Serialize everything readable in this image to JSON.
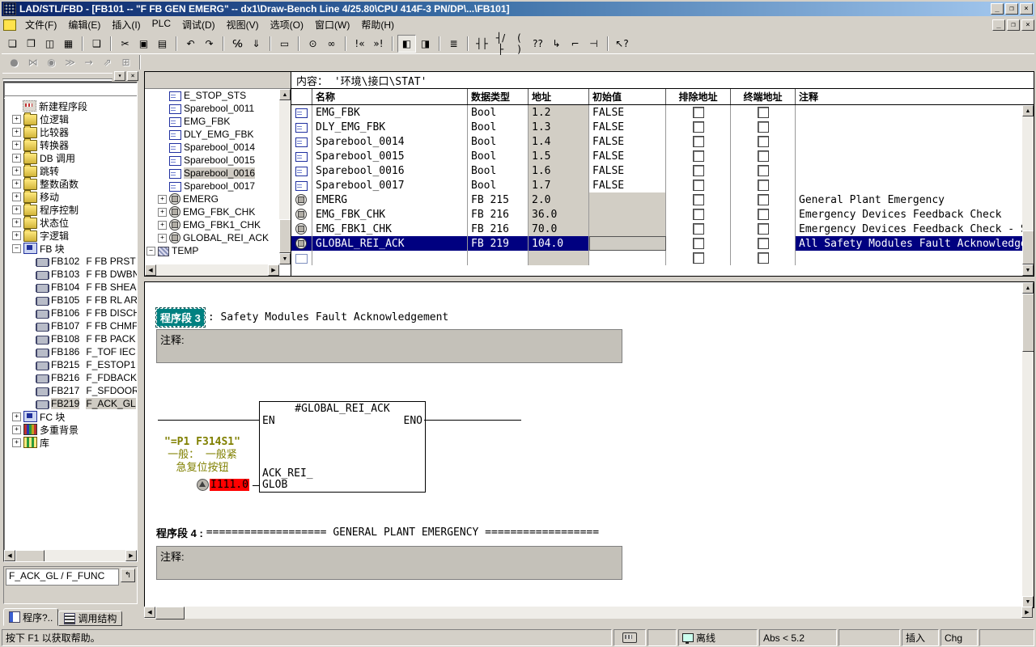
{
  "colors": {
    "accent": "#000080",
    "network_select": "#008080",
    "operand_error": "#ff0000",
    "symbol_text": "#808000",
    "chrome": "#d4d0c8"
  },
  "window": {
    "title": "LAD/STL/FBD  - [FB101 -- \"F FB GEN EMERG\" -- dx1\\Draw-Bench Line 4/25.80\\CPU 414F-3 PN/DP\\...\\FB101]",
    "min": "_",
    "restore": "❐",
    "close": "×"
  },
  "menu": {
    "items": [
      "文件(F)",
      "编辑(E)",
      "插入(I)",
      "PLC",
      "调试(D)",
      "视图(V)",
      "选项(O)",
      "窗口(W)",
      "帮助(H)"
    ]
  },
  "toolbar": {
    "row1": [
      {
        "name": "new-document-icon",
        "glyph": "❏",
        "inter": "true",
        "cls": ""
      },
      {
        "name": "open-icon",
        "glyph": "❒",
        "inter": "true",
        "cls": ""
      },
      {
        "name": "save-all-icon",
        "glyph": "◫",
        "inter": "true",
        "cls": ""
      },
      {
        "name": "save-icon",
        "glyph": "▦",
        "inter": "true",
        "cls": ""
      },
      {
        "name": "separator",
        "glyph": "",
        "inter": "false",
        "cls": "sep2"
      },
      {
        "name": "print-icon",
        "glyph": "❑",
        "inter": "true",
        "cls": ""
      },
      {
        "name": "separator",
        "glyph": "",
        "inter": "false",
        "cls": "sep2"
      },
      {
        "name": "cut-icon",
        "glyph": "✂",
        "inter": "true",
        "cls": ""
      },
      {
        "name": "copy-icon",
        "glyph": "▣",
        "inter": "true",
        "cls": ""
      },
      {
        "name": "paste-icon",
        "glyph": "▤",
        "inter": "true",
        "cls": ""
      },
      {
        "name": "separator",
        "glyph": "",
        "inter": "false",
        "cls": "sep2"
      },
      {
        "name": "undo-icon",
        "glyph": "↶",
        "inter": "true",
        "cls": ""
      },
      {
        "name": "redo-icon",
        "glyph": "↷",
        "inter": "true",
        "cls": ""
      },
      {
        "name": "separator",
        "glyph": "",
        "inter": "false",
        "cls": "sep2"
      },
      {
        "name": "goto-address-icon",
        "glyph": "℅",
        "inter": "true",
        "cls": ""
      },
      {
        "name": "download-icon",
        "glyph": "⇓",
        "inter": "true",
        "cls": ""
      },
      {
        "name": "separator",
        "glyph": "",
        "inter": "false",
        "cls": "sep2"
      },
      {
        "name": "symbol-table-icon",
        "glyph": "▭",
        "inter": "true",
        "cls": ""
      },
      {
        "name": "separator",
        "glyph": "",
        "inter": "false",
        "cls": "sep2"
      },
      {
        "name": "symbol-info-icon",
        "glyph": "⊙",
        "inter": "true",
        "cls": ""
      },
      {
        "name": "monitor-glasses-icon",
        "glyph": "∞",
        "inter": "true",
        "cls": ""
      },
      {
        "name": "separator",
        "glyph": "",
        "inter": "false",
        "cls": "sep2"
      },
      {
        "name": "previous-error-icon",
        "glyph": "!«",
        "inter": "true",
        "cls": ""
      },
      {
        "name": "next-error-icon",
        "glyph": "»!",
        "inter": "true",
        "cls": ""
      },
      {
        "name": "separator",
        "glyph": "",
        "inter": "false",
        "cls": "sep2"
      },
      {
        "name": "overview-toggle-icon",
        "glyph": "◧",
        "inter": "true",
        "cls": "pressed"
      },
      {
        "name": "detail-view-icon",
        "glyph": "◨",
        "inter": "true",
        "cls": ""
      },
      {
        "name": "separator",
        "glyph": "",
        "inter": "false",
        "cls": "sep2"
      },
      {
        "name": "new-network-icon",
        "glyph": "≣",
        "inter": "true",
        "cls": ""
      },
      {
        "name": "separator",
        "glyph": "",
        "inter": "false",
        "cls": "sep2"
      },
      {
        "name": "contact-no-icon",
        "glyph": "┤├",
        "inter": "true",
        "cls": ""
      },
      {
        "name": "contact-nc-icon",
        "glyph": "┤/├",
        "inter": "true",
        "cls": ""
      },
      {
        "name": "coil-icon",
        "glyph": "( )",
        "inter": "true",
        "cls": ""
      },
      {
        "name": "empty-box-icon",
        "glyph": "??",
        "inter": "true",
        "cls": ""
      },
      {
        "name": "open-branch-icon",
        "glyph": "↳",
        "inter": "true",
        "cls": ""
      },
      {
        "name": "rung-up-icon",
        "glyph": "⌐",
        "inter": "true",
        "cls": ""
      },
      {
        "name": "close-branch-icon",
        "glyph": "⊣",
        "inter": "true",
        "cls": ""
      },
      {
        "name": "separator",
        "glyph": "",
        "inter": "false",
        "cls": "sep2"
      },
      {
        "name": "help-select-icon",
        "glyph": "↖?",
        "inter": "true",
        "cls": ""
      }
    ],
    "row2": [
      {
        "name": "breakpoint-icon",
        "glyph": "●",
        "inter": "false",
        "cls": "dis"
      },
      {
        "name": "monitor-off-icon",
        "glyph": "⋈",
        "inter": "false",
        "cls": "dis"
      },
      {
        "name": "monitor-variable-icon",
        "glyph": "◉",
        "inter": "false",
        "cls": "dis"
      },
      {
        "name": "step-over-icon",
        "glyph": "≫",
        "inter": "false",
        "cls": "dis"
      },
      {
        "name": "run-to-icon",
        "glyph": "→",
        "inter": "false",
        "cls": "dis"
      },
      {
        "name": "open-called-block-icon",
        "glyph": "⇗",
        "inter": "false",
        "cls": "dis"
      },
      {
        "name": "window-list-icon",
        "glyph": "⊞",
        "inter": "false",
        "cls": "dis"
      },
      {
        "name": "separator",
        "glyph": "",
        "inter": "false",
        "cls": "sep2"
      }
    ]
  },
  "panel": {
    "dropdown": "▾",
    "close": "×"
  },
  "catalog": {
    "items": [
      {
        "cls": "noexp",
        "expand": "",
        "icon": "newnet",
        "iconname": "new-network-icon",
        "label": "新建程序段",
        "label2": ""
      },
      {
        "cls": "",
        "expand": "+",
        "icon": "folder",
        "iconname": "bit-logic-folder-icon",
        "label": "位逻辑",
        "label2": ""
      },
      {
        "cls": "",
        "expand": "+",
        "icon": "folder",
        "iconname": "comparator-folder-icon",
        "label": "比较器",
        "label2": ""
      },
      {
        "cls": "",
        "expand": "+",
        "icon": "folder",
        "iconname": "converter-folder-icon",
        "label": "转换器",
        "label2": ""
      },
      {
        "cls": "",
        "expand": "+",
        "icon": "folder",
        "iconname": "db-call-folder-icon",
        "label": "DB 调用",
        "label2": ""
      },
      {
        "cls": "",
        "expand": "+",
        "icon": "folder",
        "iconname": "jump-folder-icon",
        "label": "跳转",
        "label2": ""
      },
      {
        "cls": "",
        "expand": "+",
        "icon": "folder",
        "iconname": "integer-functions-folder-icon",
        "label": "整数函数",
        "label2": ""
      },
      {
        "cls": "",
        "expand": "+",
        "icon": "folder",
        "iconname": "move-folder-icon",
        "label": "移动",
        "label2": ""
      },
      {
        "cls": "",
        "expand": "+",
        "icon": "folder",
        "iconname": "program-control-folder-icon",
        "label": "程序控制",
        "label2": ""
      },
      {
        "cls": "",
        "expand": "+",
        "icon": "folder",
        "iconname": "status-bits-folder-icon",
        "label": "状态位",
        "label2": ""
      },
      {
        "cls": "",
        "expand": "+",
        "icon": "folder",
        "iconname": "word-logic-folder-icon",
        "label": "字逻辑",
        "label2": ""
      },
      {
        "cls": "",
        "expand": "−",
        "icon": "fbfolder",
        "iconname": "fb-blocks-folder-icon",
        "label": "FB 块",
        "label2": ""
      },
      {
        "cls": "child",
        "expand": "",
        "icon": "chip",
        "iconname": "fb-block-icon",
        "label": "FB102",
        "label2": "F FB PRST A"
      },
      {
        "cls": "child",
        "expand": "",
        "icon": "chip",
        "iconname": "fb-block-icon",
        "label": "FB103",
        "label2": "F FB DWBN"
      },
      {
        "cls": "child",
        "expand": "",
        "icon": "chip",
        "iconname": "fb-block-icon",
        "label": "FB104",
        "label2": "F FB SHEAR"
      },
      {
        "cls": "child",
        "expand": "",
        "icon": "chip",
        "iconname": "fb-block-icon",
        "label": "FB105",
        "label2": "F FB RL ARE"
      },
      {
        "cls": "child",
        "expand": "",
        "icon": "chip",
        "iconname": "fb-block-icon",
        "label": "FB106",
        "label2": "F FB DISCH"
      },
      {
        "cls": "child",
        "expand": "",
        "icon": "chip",
        "iconname": "fb-block-icon",
        "label": "FB107",
        "label2": "F FB CHMF"
      },
      {
        "cls": "child",
        "expand": "",
        "icon": "chip",
        "iconname": "fb-block-icon",
        "label": "FB108",
        "label2": "F FB PACK A"
      },
      {
        "cls": "child",
        "expand": "",
        "icon": "chip",
        "iconname": "fb-block-icon",
        "label": "FB186",
        "label2": "F_TOF  IEC"
      },
      {
        "cls": "child",
        "expand": "",
        "icon": "chip",
        "iconname": "fb-block-icon",
        "label": "FB215",
        "label2": "F_ESTOP1"
      },
      {
        "cls": "child",
        "expand": "",
        "icon": "chip",
        "iconname": "fb-block-icon",
        "label": "FB216",
        "label2": "F_FDBACK"
      },
      {
        "cls": "child",
        "expand": "",
        "icon": "chip",
        "iconname": "fb-block-icon",
        "label": "FB217",
        "label2": "F_SFDOOR"
      },
      {
        "cls": "child selrow",
        "expand": "",
        "icon": "chip",
        "iconname": "fb-block-icon",
        "label": "FB219",
        "label2": "F_ACK_GL"
      },
      {
        "cls": "",
        "expand": "+",
        "icon": "fbfolder",
        "iconname": "fc-blocks-folder-icon",
        "label": "FC 块",
        "label2": ""
      },
      {
        "cls": "",
        "expand": "+",
        "icon": "books",
        "iconname": "multi-instance-icon",
        "label": "多重背景",
        "label2": ""
      },
      {
        "cls": "",
        "expand": "+",
        "icon": "booksy",
        "iconname": "library-icon",
        "label": "库",
        "label2": ""
      }
    ],
    "overview_text": "F_ACK_GL / F_FUNC",
    "open_block_glyph": "↰",
    "tabs": [
      {
        "label": "程序?..",
        "iconname": "program-elements-icon",
        "cls": "",
        "iccls": ""
      },
      {
        "label": "调用结构",
        "iconname": "call-structure-icon",
        "cls": "inactive",
        "iccls": "calls"
      }
    ]
  },
  "iface": {
    "items": [
      {
        "cls": "",
        "expand": "",
        "icon": "var",
        "iconname": "variable-icon",
        "label": "E_STOP_STS"
      },
      {
        "cls": "",
        "expand": "",
        "icon": "var",
        "iconname": "variable-icon",
        "label": "Sparebool_0011"
      },
      {
        "cls": "",
        "expand": "",
        "icon": "var",
        "iconname": "variable-icon",
        "label": "EMG_FBK"
      },
      {
        "cls": "",
        "expand": "",
        "icon": "var",
        "iconname": "variable-icon",
        "label": "DLY_EMG_FBK"
      },
      {
        "cls": "",
        "expand": "",
        "icon": "var",
        "iconname": "variable-icon",
        "label": "Sparebool_0014"
      },
      {
        "cls": "",
        "expand": "",
        "icon": "var",
        "iconname": "variable-icon",
        "label": "Sparebool_0015"
      },
      {
        "cls": "hsel",
        "expand": "",
        "icon": "var",
        "iconname": "variable-icon",
        "label": "Sparebool_0016"
      },
      {
        "cls": "",
        "expand": "",
        "icon": "var",
        "iconname": "variable-icon",
        "label": "Sparebool_0017"
      },
      {
        "cls": "sub",
        "expand": "+",
        "icon": "inst",
        "iconname": "instance-block-icon",
        "label": "EMERG"
      },
      {
        "cls": "sub",
        "expand": "+",
        "icon": "inst",
        "iconname": "instance-block-icon",
        "label": "EMG_FBK_CHK"
      },
      {
        "cls": "sub",
        "expand": "+",
        "icon": "inst",
        "iconname": "instance-block-icon",
        "label": "EMG_FBK1_CHK"
      },
      {
        "cls": "sub",
        "expand": "+",
        "icon": "inst",
        "iconname": "instance-block-icon",
        "label": "GLOBAL_REI_ACK"
      },
      {
        "cls": "root",
        "expand": "−",
        "icon": "temp",
        "iconname": "temp-section-icon",
        "label": "TEMP"
      }
    ]
  },
  "table": {
    "content_label": "内容：  '环境\\接口\\STAT'",
    "columns": [
      {
        "label": "名称",
        "cls": "c-name"
      },
      {
        "label": "数据类型",
        "cls": "c-type"
      },
      {
        "label": "地址",
        "cls": "c-addr"
      },
      {
        "label": "初始值",
        "cls": "c-init"
      },
      {
        "label": "排除地址",
        "cls": "c-x"
      },
      {
        "label": "终端地址",
        "cls": "c-t"
      },
      {
        "label": "注释",
        "cls": "c-com"
      }
    ],
    "rows": [
      {
        "cls": "",
        "icon": "var",
        "iconname": "variable-icon",
        "name": "EMG_FBK",
        "type": "Bool",
        "addr": "1.2",
        "init": "FALSE",
        "comment": ""
      },
      {
        "cls": "",
        "icon": "var",
        "iconname": "variable-icon",
        "name": "DLY_EMG_FBK",
        "type": "Bool",
        "addr": "1.3",
        "init": "FALSE",
        "comment": ""
      },
      {
        "cls": "",
        "icon": "var",
        "iconname": "variable-icon",
        "name": "Sparebool_0014",
        "type": "Bool",
        "addr": "1.4",
        "init": "FALSE",
        "comment": ""
      },
      {
        "cls": "",
        "icon": "var",
        "iconname": "variable-icon",
        "name": "Sparebool_0015",
        "type": "Bool",
        "addr": "1.5",
        "init": "FALSE",
        "comment": ""
      },
      {
        "cls": "",
        "icon": "var",
        "iconname": "variable-icon",
        "name": "Sparebool_0016",
        "type": "Bool",
        "addr": "1.6",
        "init": "FALSE",
        "comment": ""
      },
      {
        "cls": "",
        "icon": "var",
        "iconname": "variable-icon",
        "name": "Sparebool_0017",
        "type": "Bool",
        "addr": "1.7",
        "init": "FALSE",
        "comment": ""
      },
      {
        "cls": "fb",
        "icon": "inst",
        "iconname": "instance-block-icon",
        "name": "EMERG",
        "type": "FB 215",
        "addr": "2.0",
        "init": "",
        "comment": "General Plant Emergency"
      },
      {
        "cls": "fb",
        "icon": "inst",
        "iconname": "instance-block-icon",
        "name": "EMG_FBK_CHK",
        "type": "FB 216",
        "addr": "36.0",
        "init": "",
        "comment": "Emergency Devices Feedback Check"
      },
      {
        "cls": "fb",
        "icon": "inst",
        "iconname": "instance-block-icon",
        "name": "EMG_FBK1_CHK",
        "type": "FB 216",
        "addr": "70.0",
        "init": "",
        "comment": "Emergency Devices Feedback Check - S..."
      },
      {
        "cls": "fb sel",
        "icon": "inst",
        "iconname": "instance-block-icon",
        "name": "GLOBAL_REI_ACK",
        "type": "FB 219",
        "addr": "104.0",
        "init": "",
        "comment": "All Safety Modules Fault Acknowledge..."
      },
      {
        "cls": "",
        "icon": "varempty",
        "iconname": "empty-declaration-icon",
        "name": "",
        "type": "",
        "addr": "",
        "init": "",
        "comment": ""
      }
    ]
  },
  "code": {
    "net3_label": "程序段 3",
    "net3_title": ": Safety Modules Fault Acknowledgement",
    "comment_label": "注释:",
    "block": {
      "title": "#GLOBAL_REI_ACK",
      "en": "EN",
      "eno": "ENO",
      "param1": "ACK_REI_",
      "param2": "GLOB",
      "operand": "I111.0",
      "symbol": "\"=P1 F314S1\"",
      "sym1": "一般： 一般紧",
      "sym2": "急复位按钮"
    },
    "net4_label": "程序段 4 :",
    "net4_title": "=================== GENERAL PLANT EMERGENCY =================="
  },
  "status": {
    "help": "按下 F1 以获取帮助。",
    "offline": "离线",
    "abs": "Abs < 5.2",
    "insert": "插入",
    "chg": "Chg"
  },
  "glyphs": {
    "up": "▲",
    "down": "▼",
    "left": "◀",
    "right": "▶"
  }
}
